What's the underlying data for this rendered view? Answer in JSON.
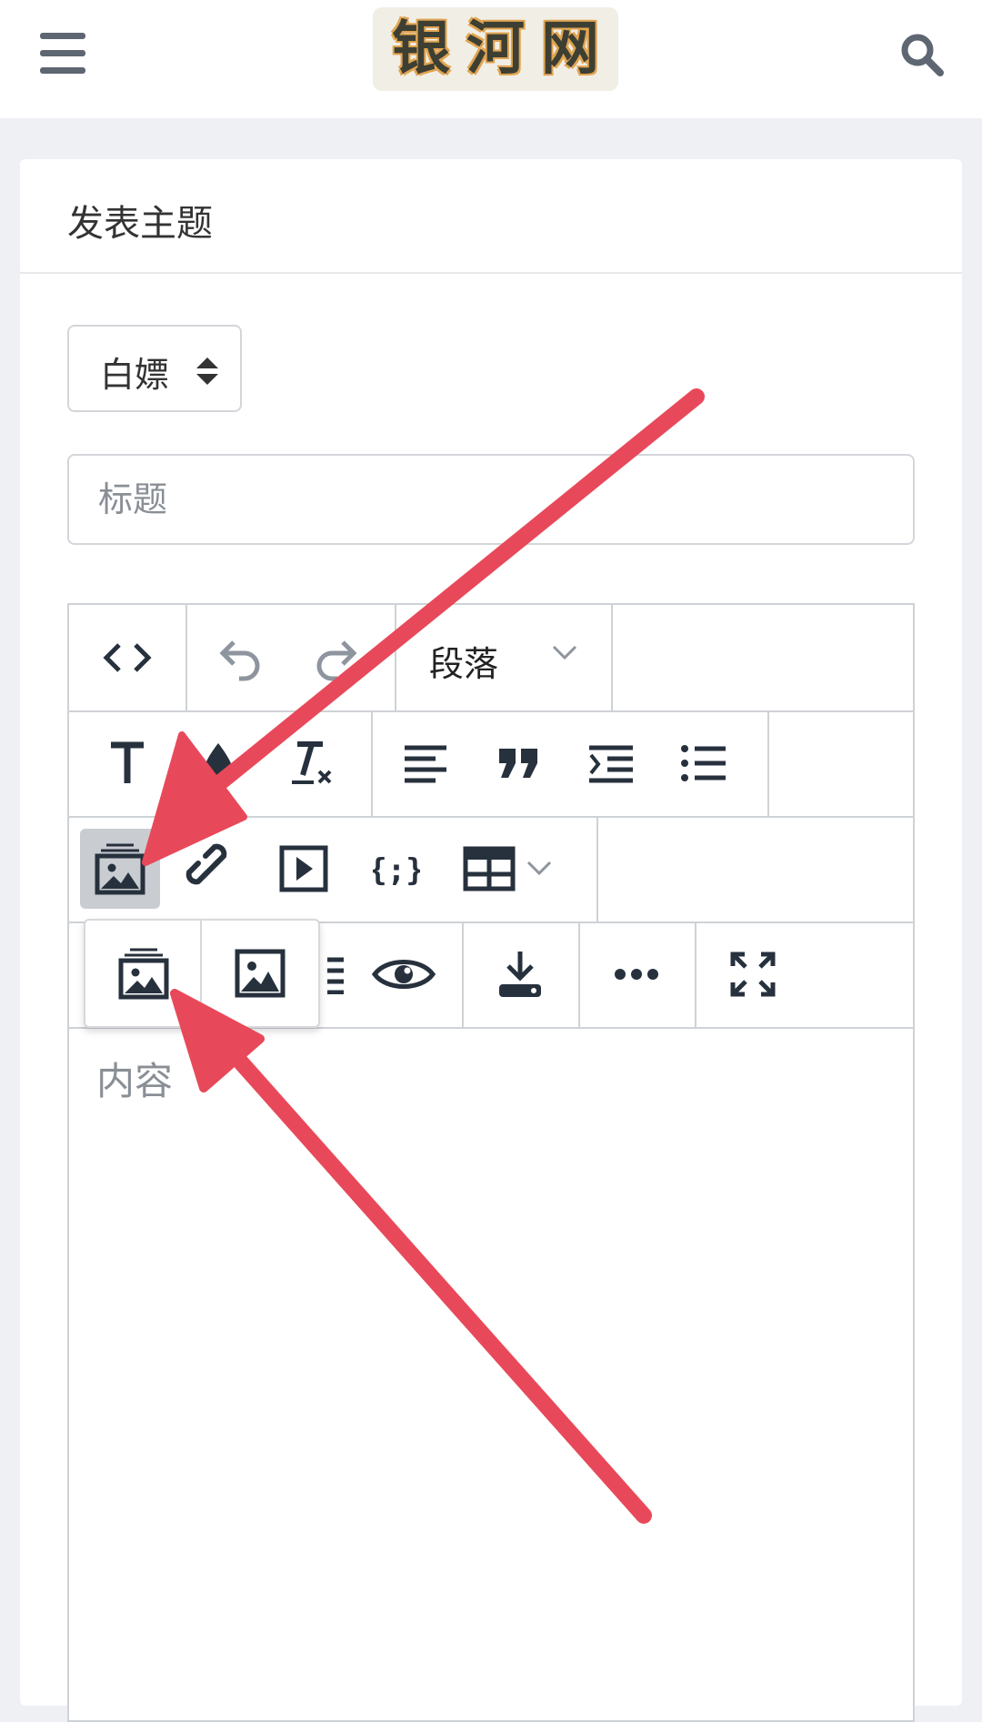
{
  "header": {
    "logo_text": "银河网",
    "menu_icon": "hamburger-menu-icon",
    "search_icon": "search-icon"
  },
  "card": {
    "title": "发表主题"
  },
  "form": {
    "category_value": "白嫖",
    "title_placeholder": "标题",
    "content_placeholder": "内容"
  },
  "toolbar": {
    "paragraph_label": "段落",
    "row1": [
      "code-view-icon",
      "undo-icon",
      "redo-icon",
      "paragraph-dropdown"
    ],
    "row2": [
      "text-size-icon",
      "text-color-icon",
      "clear-format-icon",
      "align-left-icon",
      "blockquote-icon",
      "indent-icon",
      "bullet-list-icon"
    ],
    "row3": [
      "image-gallery-icon",
      "link-icon",
      "video-icon",
      "code-block-icon",
      "table-icon"
    ],
    "row4": [
      "list-icon",
      "preview-eye-icon",
      "download-icon",
      "more-icon",
      "fullscreen-icon"
    ]
  },
  "image_popup": {
    "items": [
      "insert-multiple-images-icon",
      "insert-image-icon"
    ]
  },
  "colors": {
    "accent_arrow": "#e8495a",
    "icon": "#27313d",
    "icon_muted": "#8e959e"
  }
}
